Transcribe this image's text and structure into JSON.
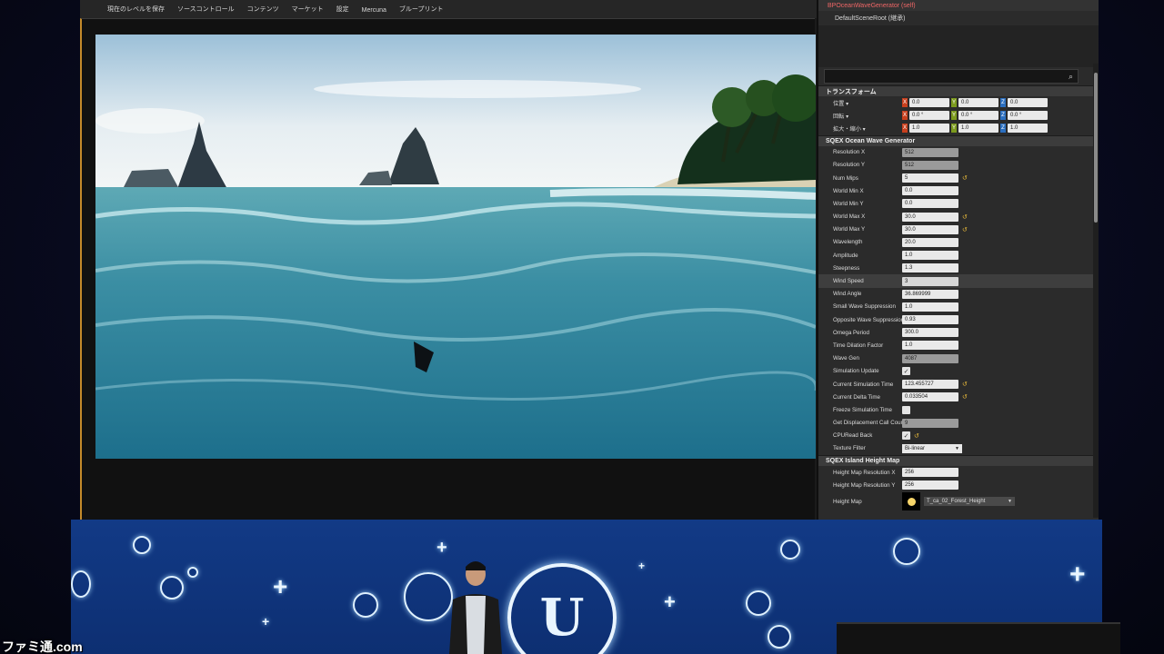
{
  "toolbar": {
    "items": [
      "現在のレベルを保存",
      "ソースコントロール",
      "コンテンツ",
      "マーケット",
      "設定",
      "Mercuna",
      "ブループリント"
    ]
  },
  "details": {
    "component_self": "BPOceanWaveGenerator (self)",
    "component_root": "DefaultSceneRoot (継承)",
    "sections": {
      "transform": "トランスフォーム",
      "ocean": "SQEX Ocean Wave Generator",
      "island": "SQEX Island Height Map"
    },
    "transform": {
      "location_label": "位置 ▾",
      "rotation_label": "回転 ▾",
      "scale_label": "拡大・縮小 ▾",
      "location": [
        "0.0",
        "0.0",
        "0.0"
      ],
      "rotation": [
        "0.0 °",
        "0.0 °",
        "0.0 °"
      ],
      "scale": [
        "1.0",
        "1.0",
        "1.0"
      ]
    },
    "ocean_rows": [
      {
        "label": "Resolution X",
        "value": "512",
        "ro": true
      },
      {
        "label": "Resolution Y",
        "value": "512",
        "ro": true
      },
      {
        "label": "Num Mips",
        "value": "5",
        "reset": true
      },
      {
        "label": "World Min X",
        "value": "0.0"
      },
      {
        "label": "World Min Y",
        "value": "0.0"
      },
      {
        "label": "World Max X",
        "value": "30.0",
        "reset": true
      },
      {
        "label": "World Max Y",
        "value": "30.0",
        "reset": true
      },
      {
        "label": "Wavelength",
        "value": "20.0"
      },
      {
        "label": "Amplitude",
        "value": "1.0"
      },
      {
        "label": "Steepness",
        "value": "1.3"
      },
      {
        "label": "Wind Speed",
        "value": "3",
        "hl": true
      },
      {
        "label": "Wind Angle",
        "value": "36.869999"
      },
      {
        "label": "Small Wave Suppression",
        "value": "1.0"
      },
      {
        "label": "Opposite Wave Suppression",
        "value": "0.93"
      },
      {
        "label": "Omega Period",
        "value": "300.0"
      },
      {
        "label": "Time Dilation Factor",
        "value": "1.0"
      },
      {
        "label": "Wave Gen",
        "value": "4087",
        "ro": true
      },
      {
        "label": "Simulation Update",
        "check": true
      },
      {
        "label": "Current Simulation Time",
        "value": "123.455727",
        "reset": true
      },
      {
        "label": "Current Delta Time",
        "value": "0.033504",
        "reset": true
      },
      {
        "label": "Freeze Simulation Time",
        "check": false
      },
      {
        "label": "Get Displacement Call Count",
        "value": "9",
        "ro": true
      },
      {
        "label": "CPURead Back",
        "check": true,
        "reset": true
      },
      {
        "label": "Texture Filter",
        "dropdown": "Bi-linear"
      }
    ],
    "island_rows": [
      {
        "label": "Height Map Resolution X",
        "value": "256"
      },
      {
        "label": "Height Map Resolution Y",
        "value": "256"
      }
    ],
    "height_map": {
      "label": "Height Map",
      "asset": "T_ca_02_Forest_Height"
    }
  },
  "watermark": "ファミ通.com",
  "colors": {
    "accent": "#c38a2a",
    "backdrop": "#123a86",
    "reset_arrow": "#e1b43a"
  }
}
